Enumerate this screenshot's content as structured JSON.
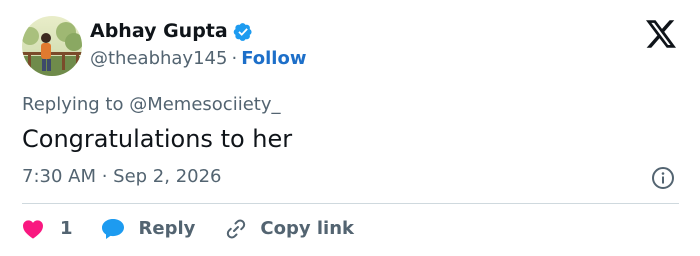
{
  "author": {
    "display_name": "Abhay Gupta",
    "handle": "@theabhay145",
    "separator": "·",
    "follow_label": "Follow",
    "verified": true,
    "avatar_icon": "avatar-image"
  },
  "brand": {
    "logo_icon": "x-logo-icon"
  },
  "tweet": {
    "replying_to": "Replying to @Memesociiety_",
    "text": "Congratulations to her",
    "timestamp": "7:30 AM · Sep 2, 2026"
  },
  "actions": {
    "like_count": "1",
    "reply_label": "Reply",
    "copy_link_label": "Copy link"
  },
  "colors": {
    "text": "#0f1419",
    "secondary": "#536471",
    "link": "#1d6fc9",
    "verified": "#1d9bf0",
    "like": "#f91880",
    "divider": "#cfd9de"
  }
}
